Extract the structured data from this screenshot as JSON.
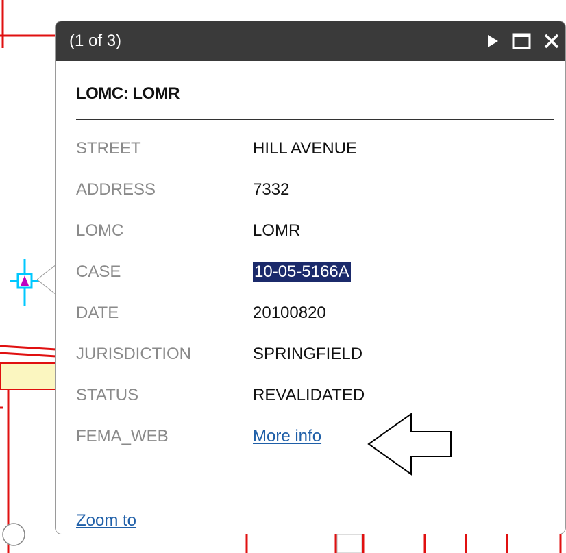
{
  "popup": {
    "page_count": "(1 of 3)",
    "layer_title": "LOMC: LOMR",
    "attributes": [
      {
        "key": "STREET",
        "value": "HILL AVENUE"
      },
      {
        "key": "ADDRESS",
        "value": "7332"
      },
      {
        "key": "LOMC",
        "value": "LOMR"
      },
      {
        "key": "CASE",
        "value": "10-05-5166A"
      },
      {
        "key": "DATE",
        "value": "20100820"
      },
      {
        "key": "JURISDICTION",
        "value": "SPRINGFIELD"
      },
      {
        "key": "STATUS",
        "value": "REVALIDATED"
      },
      {
        "key": "FEMA_WEB",
        "value": "More info"
      }
    ],
    "zoom_link": "Zoom to",
    "controls": [
      "next-icon",
      "maximize-icon",
      "close-icon"
    ]
  },
  "colors": {
    "titlebar": "#3a3a3a",
    "link": "#1f5fa8",
    "highlight": "#1b2a6b",
    "map_lines": "#e01010",
    "map_fill": "#fbf6c0",
    "selected_marker": "#00c8ff"
  }
}
